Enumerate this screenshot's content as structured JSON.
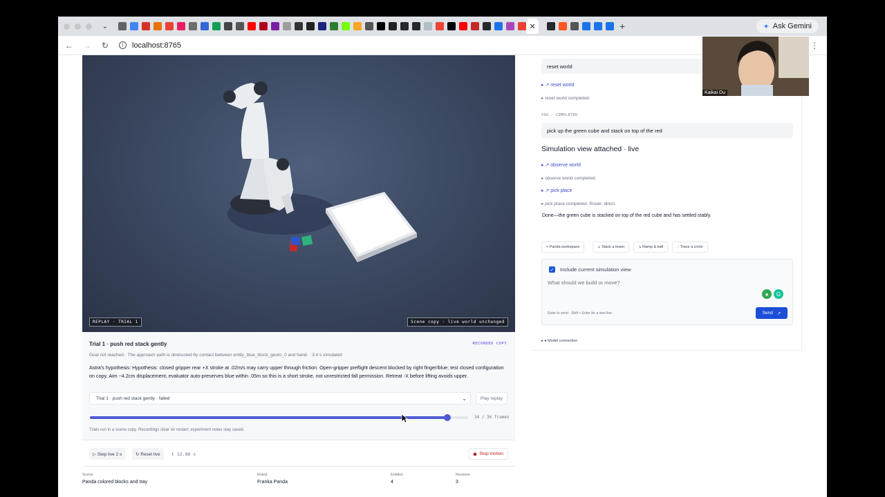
{
  "browser": {
    "address": "localhost:8765",
    "ask_gemini": "Ask Gemini",
    "new_tab": "+",
    "active_tab_close": "✕"
  },
  "viewport": {
    "replay_badge": "REPLAY · TRIAL 1",
    "scene_badge": "Scene copy · live world unchanged"
  },
  "trial": {
    "title": "Trial 1 · push red stack gently",
    "recorded_label": "RECORDED COPY",
    "goal_text": "Goal not reached · The approach path is obstructed by contact between entity_blue_block_geom_0 and hand. · 3.4 s simulated",
    "hypothesis": "Astra's hypothesis: Hypothesis: closed gripper rear +X stroke at .02m/s may carry upper through friction. Open-gripper preflight descent blocked by right finger/blue; test closed configuration on copy. Aim ~4.2cm displacement; evaluator auto-preserves blue within .05m so this is a short stroke, not unrestricted fall permission. Retreat -X before lifting avoids upper.",
    "select_value": "Trial 1 · push red stack gently · failed",
    "play_replay": "Play replay",
    "frame_current": 34,
    "frame_total": 36,
    "frames_label": "34 / 36 frames",
    "note": "Trials run in a scene copy. Recordings clear on restart; experiment notes stay saved."
  },
  "controls": {
    "step_live": "▷ Step live 2 s",
    "reset_live": "↻ Reset live",
    "time": "t 12.88 s",
    "stop_motion": "Stop motion"
  },
  "meta": {
    "scene_label": "Scene",
    "scene_value": "Panda colored blocks and tray",
    "robot_label": "Robot",
    "robot_value": "Franka Panda",
    "entities_label": "Entities",
    "entities_value": "4",
    "revision_label": "Revision",
    "revision_value": "3"
  },
  "chat": {
    "msg1": "reset world",
    "tool1_link": "▸ ↗ reset world",
    "tool1_done": "▸ reset world completed.",
    "you_label": "YOU · COMPLETED",
    "msg2": "pick up the green cube and stack on top of the red",
    "sim_title": "Simulation view attached · live",
    "tool2_link": "▸ ↗ observe world",
    "tool2_done": "▸ observe world completed.",
    "tool3_link": "▸ ↗ pick place",
    "tool3_done": "▸ pick place completed. Route: direct.",
    "done_text": "Done—the green cube is stacked on top of the red cube and has settled stably.",
    "chips": [
      "+ Panda workspace",
      "⇣ Stack a tower",
      "↘ Ramp & ball",
      "◌ Trace a circle"
    ],
    "include_label": "Include current simulation view",
    "composer_placeholder": "What should we build or move?",
    "hint": "Enter to send · Shift + Enter for a new line",
    "send": "Send",
    "model_connection": "▸ ● Model connection"
  },
  "video": {
    "participant_name": "Kaikai Du"
  },
  "colors": {
    "accent": "#1d4ed8",
    "link": "#3b4bc6",
    "slider": "#4f5bd5",
    "stop": "#b91c1c"
  }
}
